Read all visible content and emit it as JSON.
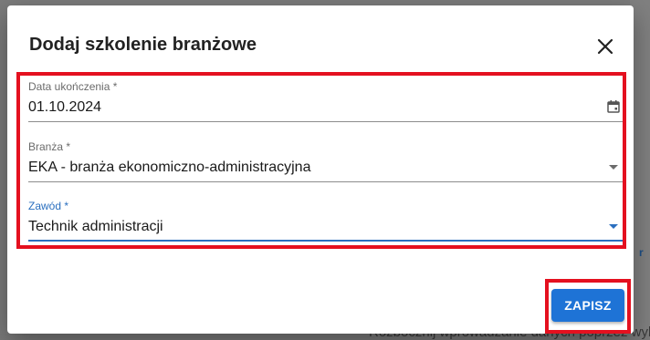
{
  "dialog": {
    "title": "Dodaj szkolenie branżowe",
    "close_icon": "close-icon"
  },
  "fields": {
    "completion_date": {
      "label": "Data ukończenia",
      "required_mark": "*",
      "value": "01.10.2024",
      "icon": "calendar-icon"
    },
    "industry": {
      "label": "Branża",
      "required_mark": "*",
      "value": "EKA - branża ekonomiczno-administracyjna",
      "icon": "chevron-down-icon"
    },
    "profession": {
      "label": "Zawód",
      "required_mark": "*",
      "value": "Technik administracji",
      "icon": "chevron-down-icon",
      "focused": true
    }
  },
  "actions": {
    "save_label": "ZAPISZ"
  },
  "background": {
    "partial_text": "Rozbocznij wprowadzanie danych poprzez wybra"
  },
  "colors": {
    "accent": "#1e73d6",
    "focus": "#2a6fbf",
    "highlight_border": "#e4101f",
    "overlay": "#7b7b7b"
  }
}
